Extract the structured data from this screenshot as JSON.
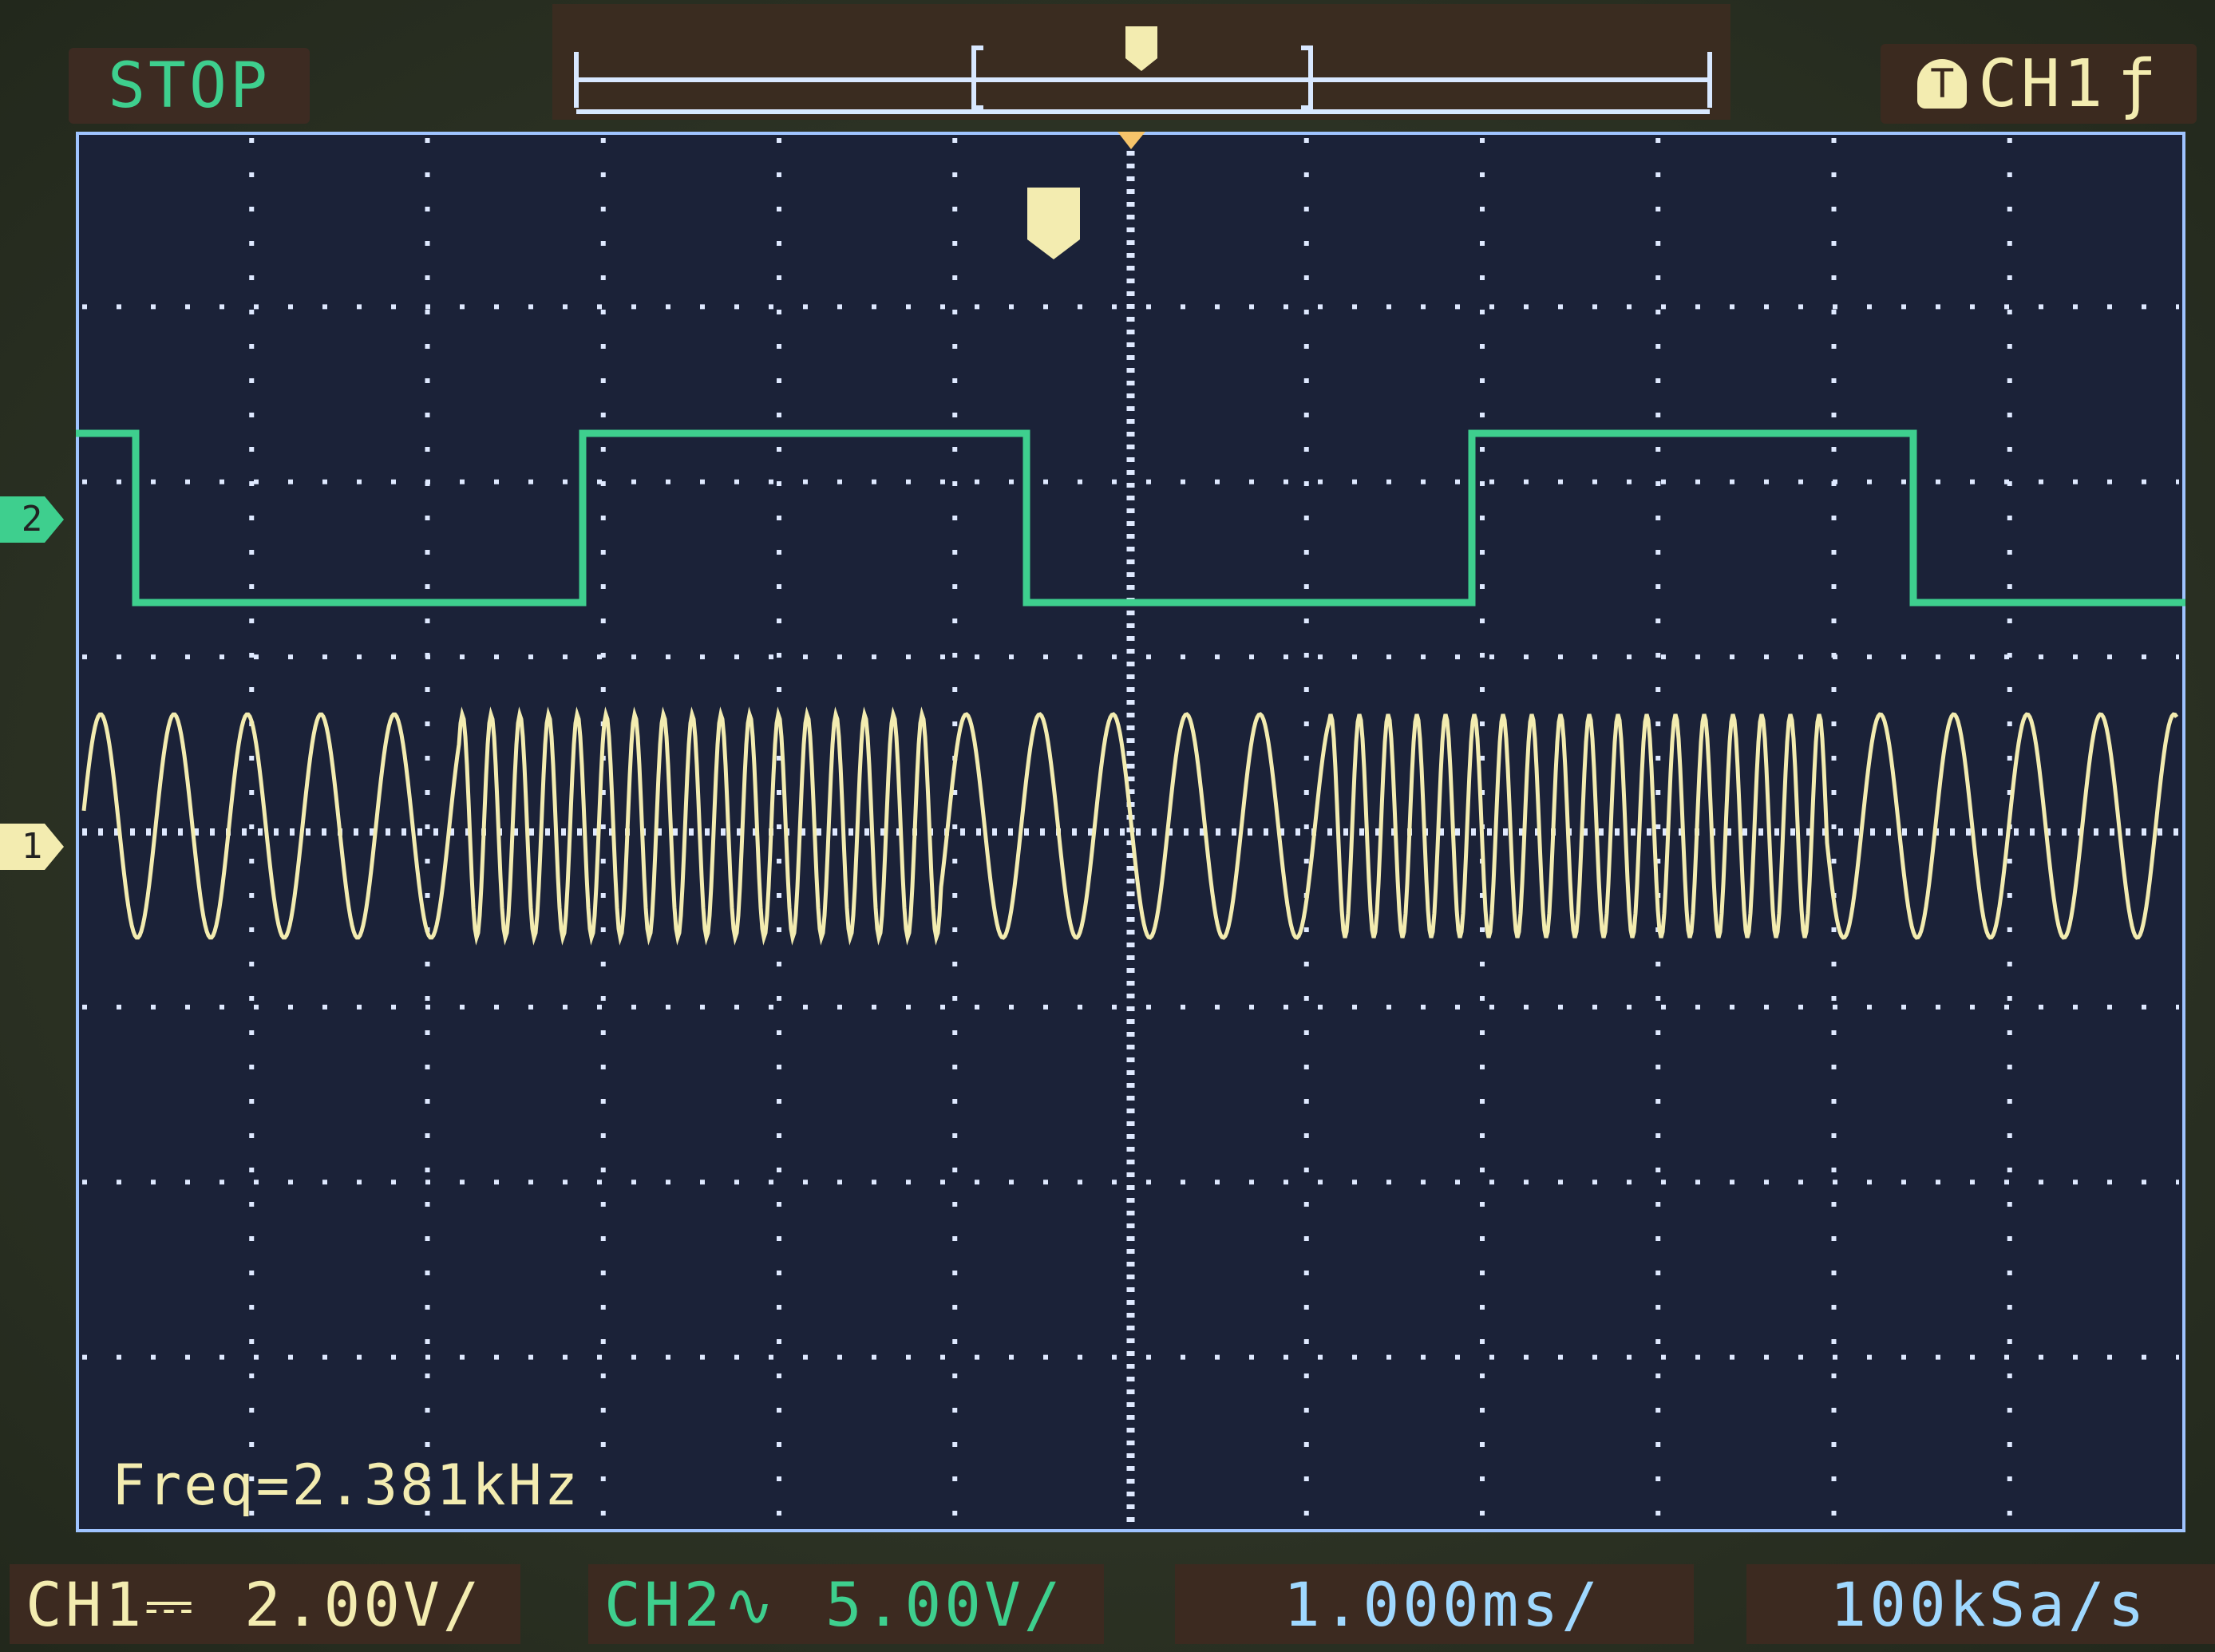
{
  "status": "STOP",
  "trigger": {
    "marker": "T",
    "source": "CH1",
    "edge_symbol": "ƒ"
  },
  "channel_markers": {
    "ch2": "2",
    "ch1": "1"
  },
  "measurement": {
    "freq": "Freq=2.381kHz"
  },
  "bottom": {
    "ch1_name": "CH1",
    "ch1_coupling": "⎓",
    "ch1_scale": "2.00V/",
    "ch2_name": "CH2",
    "ch2_coupling": "∿",
    "ch2_scale": "5.00V/",
    "timebase": "1.000ms/",
    "samplerate": "100kSa/s"
  },
  "colors": {
    "ch1": "#f3ecb0",
    "ch2": "#3ecf8e",
    "grid": "#dfe9ff",
    "border": "#9fc4ff",
    "screen_bg": "#1b2238"
  }
}
